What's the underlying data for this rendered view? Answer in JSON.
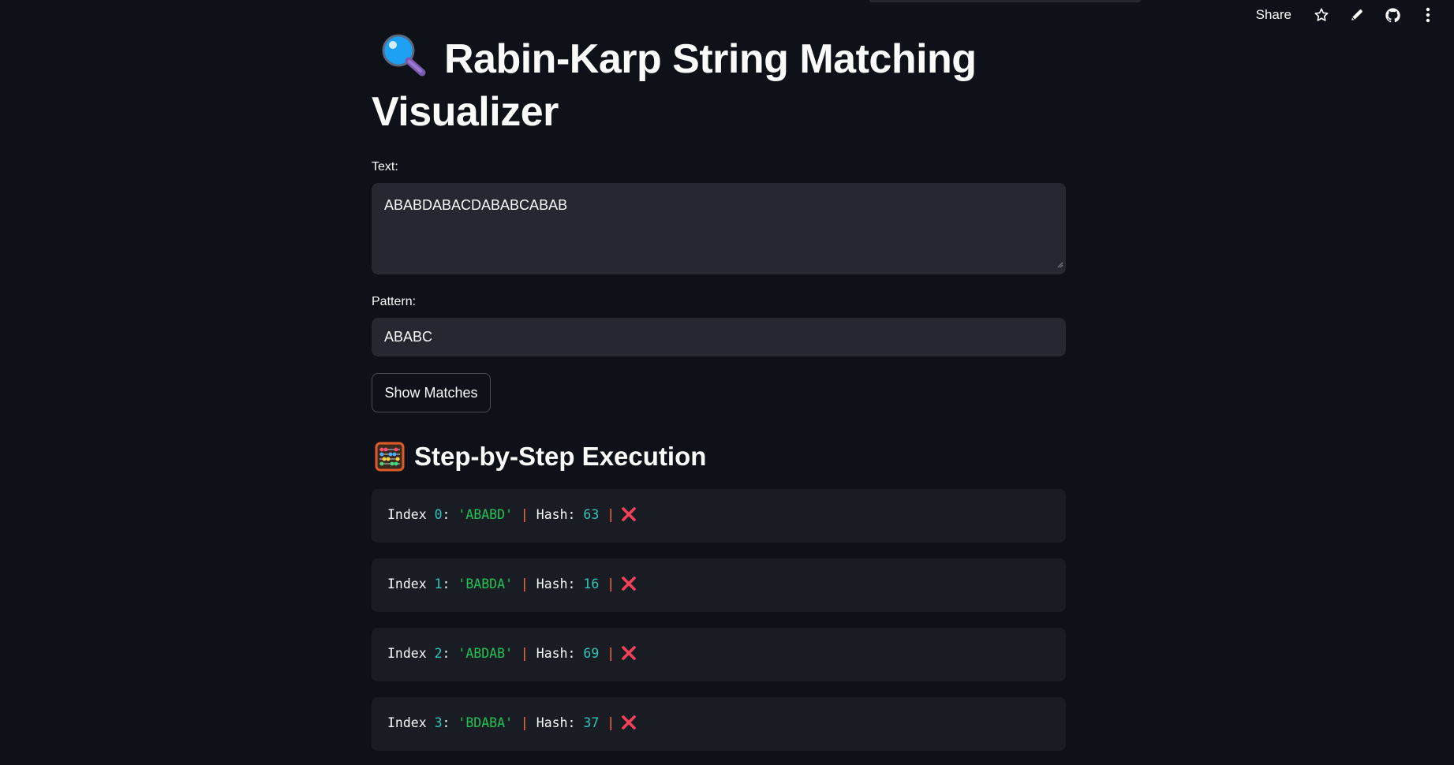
{
  "toolbar": {
    "share_label": "Share",
    "icons": [
      "star-icon",
      "pencil-icon",
      "github-icon",
      "more-vertical-icon"
    ]
  },
  "page": {
    "title_icon": "magnifying-glass-icon",
    "title": "Rabin-Karp String Matching Visualizer"
  },
  "form": {
    "text_label": "Text:",
    "text_value": "ABABDABACDABABCABAB",
    "pattern_label": "Pattern:",
    "pattern_value": "ABABC",
    "button_label": "Show Matches"
  },
  "steps_section": {
    "icon": "abacus-icon",
    "title": "Step-by-Step Execution",
    "index_word": "Index",
    "hash_word": "Hash",
    "steps": [
      {
        "index": "0",
        "window": "'ABABD'",
        "hash": "63",
        "result_icon": "cross-mark-icon"
      },
      {
        "index": "1",
        "window": "'BABDA'",
        "hash": "16",
        "result_icon": "cross-mark-icon"
      },
      {
        "index": "2",
        "window": "'ABDAB'",
        "hash": "69",
        "result_icon": "cross-mark-icon"
      },
      {
        "index": "3",
        "window": "'BDABA'",
        "hash": "37",
        "result_icon": "cross-mark-icon"
      }
    ]
  },
  "colors": {
    "background": "#0e1117",
    "input_bg": "#262730",
    "card_bg": "#1a1c24",
    "number": "#2ec4b6",
    "string": "#21c354",
    "pipe": "#ff7043",
    "cross": "#f0435a"
  }
}
